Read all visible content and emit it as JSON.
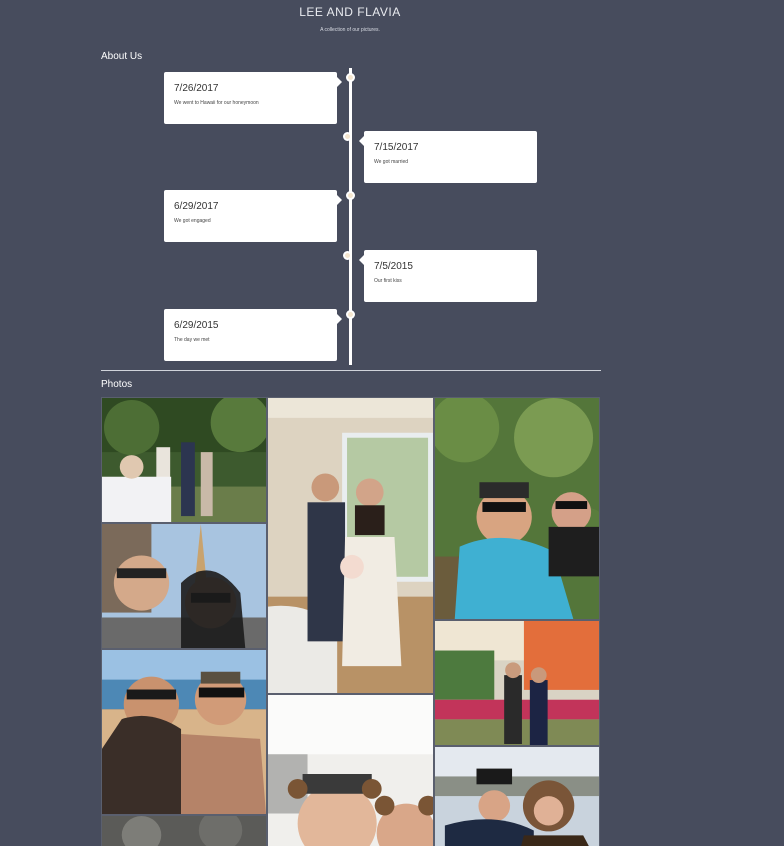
{
  "header": {
    "title": "LEE AND FLAVIA",
    "subtitle": "A collection of our pictures."
  },
  "about": {
    "label": "About Us",
    "events": [
      {
        "date": "7/26/2017",
        "description": "We went to Hawaii for our honeymoon"
      },
      {
        "date": "7/15/2017",
        "description": "We got married"
      },
      {
        "date": "6/29/2017",
        "description": "We got engaged"
      },
      {
        "date": "7/5/2015",
        "description": "Our first kiss"
      },
      {
        "date": "6/29/2015",
        "description": "The day we met"
      }
    ]
  },
  "photos": {
    "label": "Photos"
  },
  "colors": {
    "background": "#474c5d",
    "card": "#ffffff",
    "timeline_dot": "#f5e6cf"
  }
}
